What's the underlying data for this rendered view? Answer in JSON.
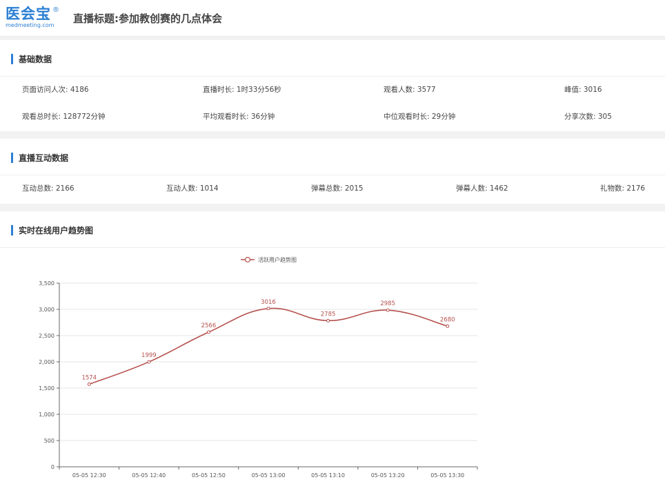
{
  "header": {
    "logo_cn": "医会宝",
    "logo_reg": "®",
    "logo_en": "medmeeting.com",
    "title": "直播标题:参加教创赛的几点体会"
  },
  "basic": {
    "title": "基础数据",
    "items": [
      "页面访问人次: 4186",
      "直播时长: 1时33分56秒",
      "观看人数: 3577",
      "峰值: 3016",
      "观看总时长: 128772分钟",
      "平均观看时长: 36分钟",
      "中位观看时长: 29分钟",
      "分享次数: 305"
    ]
  },
  "interact": {
    "title": "直播互动数据",
    "items": [
      "互动总数: 2166",
      "互动人数: 1014",
      "弹幕总数: 2015",
      "弹幕人数: 1462",
      "礼物数: 2176"
    ]
  },
  "trend": {
    "title": "实时在线用户趋势图"
  },
  "colors": {
    "accent": "#2b7fd4",
    "series": "#b5504d"
  },
  "chart_data": {
    "type": "line",
    "legend": "活跃用户趋势图",
    "legend_position": "top-center",
    "categories": [
      "05-05 12:30",
      "05-05 12:40",
      "05-05 12:50",
      "05-05 13:00",
      "05-05 13:10",
      "05-05 13:20",
      "05-05 13:30"
    ],
    "series": [
      {
        "name": "活跃用户趋势图",
        "values": [
          1574,
          1999,
          2566,
          3016,
          2785,
          2985,
          2680
        ]
      }
    ],
    "yticks": [
      "0",
      "500",
      "1,000",
      "1,500",
      "2,000",
      "2,500",
      "3,000",
      "3,500"
    ],
    "ylim": [
      0,
      3500
    ],
    "grid": true,
    "smooth": true,
    "data_labels": true
  }
}
